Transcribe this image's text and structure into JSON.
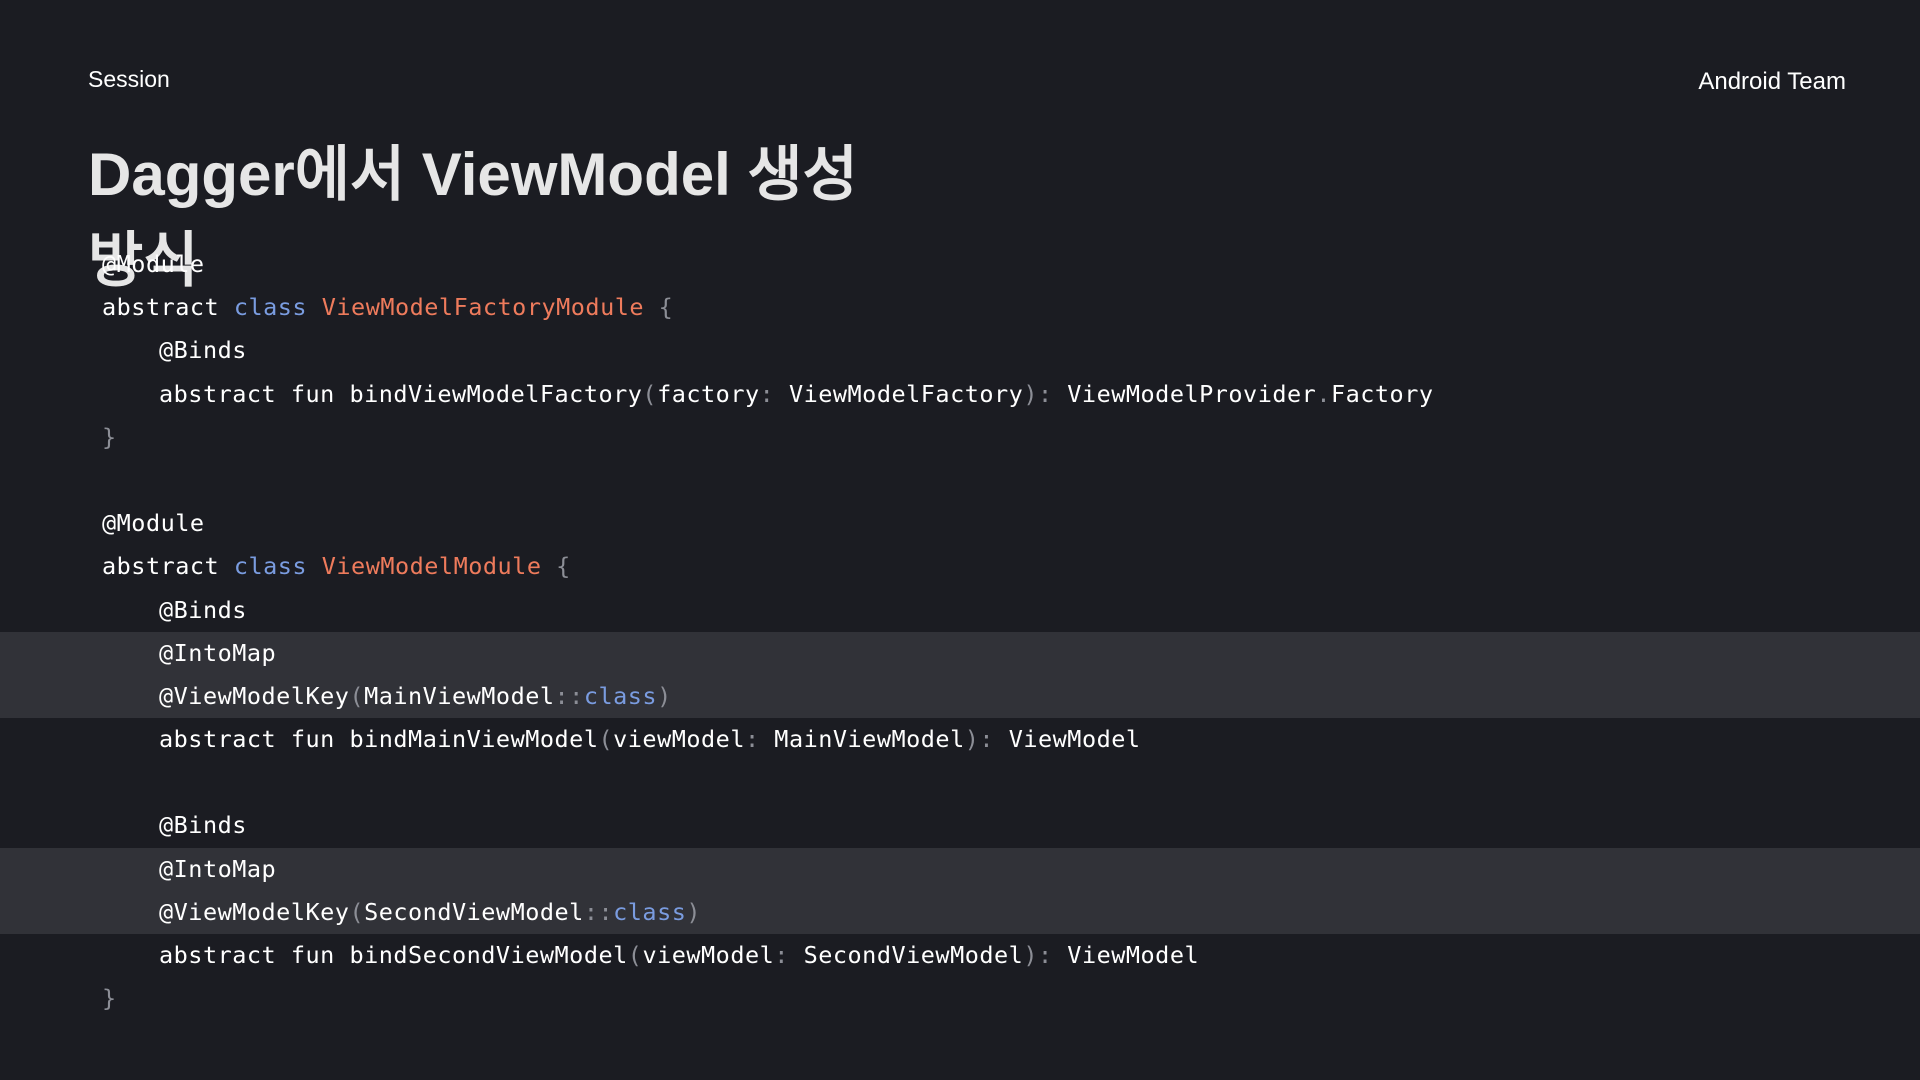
{
  "header": {
    "session_label": "Session",
    "team_label": "Android Team"
  },
  "title": "Dagger에서 ViewModel 생성 방식",
  "code": {
    "module_annotation": "@Module",
    "abstract_kw": "abstract",
    "class_kw": "class",
    "fun_kw": "fun",
    "binds_annotation": "@Binds",
    "intomap_annotation": "@IntoMap",
    "viewmodelkey_annotation": "@ViewModelKey",
    "factory_module_name": "ViewModelFactoryModule",
    "viewmodel_module_name": "ViewModelModule",
    "open_brace": "{",
    "close_brace": "}",
    "bind_factory_fn": "bindViewModelFactory",
    "factory_param": "factory",
    "factory_type": "ViewModelFactory",
    "provider_type": "ViewModelProvider",
    "factory_member": "Factory",
    "main_vm": "MainViewModel",
    "second_vm": "SecondViewModel",
    "bind_main_fn": "bindMainViewModel",
    "bind_second_fn": "bindSecondViewModel",
    "vm_param": "viewModel",
    "vm_return": "ViewModel",
    "scope_op": "::",
    "colon": ":",
    "dot": ".",
    "lparen": "(",
    "rparen": ")"
  },
  "colors": {
    "background": "#1b1c22",
    "highlight": "#313238",
    "keyword": "#7a9ce0",
    "class_name": "#ee7b5c",
    "punctuation": "#8c8e96"
  }
}
